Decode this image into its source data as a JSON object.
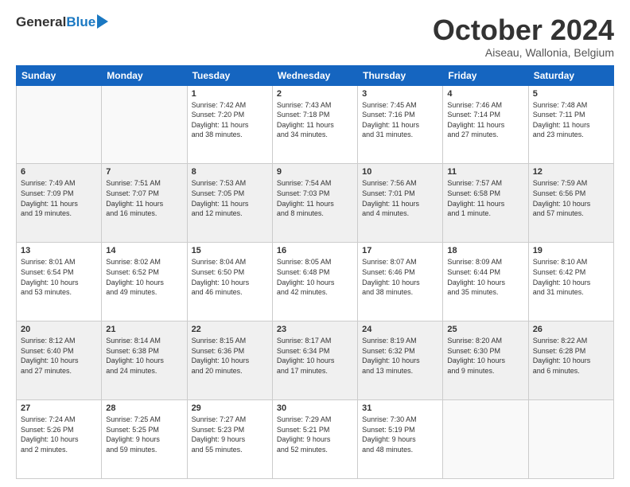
{
  "header": {
    "logo_line1": "General",
    "logo_line2": "Blue",
    "month": "October 2024",
    "location": "Aiseau, Wallonia, Belgium"
  },
  "columns": [
    "Sunday",
    "Monday",
    "Tuesday",
    "Wednesday",
    "Thursday",
    "Friday",
    "Saturday"
  ],
  "weeks": [
    [
      {
        "num": "",
        "info": ""
      },
      {
        "num": "",
        "info": ""
      },
      {
        "num": "1",
        "info": "Sunrise: 7:42 AM\nSunset: 7:20 PM\nDaylight: 11 hours\nand 38 minutes."
      },
      {
        "num": "2",
        "info": "Sunrise: 7:43 AM\nSunset: 7:18 PM\nDaylight: 11 hours\nand 34 minutes."
      },
      {
        "num": "3",
        "info": "Sunrise: 7:45 AM\nSunset: 7:16 PM\nDaylight: 11 hours\nand 31 minutes."
      },
      {
        "num": "4",
        "info": "Sunrise: 7:46 AM\nSunset: 7:14 PM\nDaylight: 11 hours\nand 27 minutes."
      },
      {
        "num": "5",
        "info": "Sunrise: 7:48 AM\nSunset: 7:11 PM\nDaylight: 11 hours\nand 23 minutes."
      }
    ],
    [
      {
        "num": "6",
        "info": "Sunrise: 7:49 AM\nSunset: 7:09 PM\nDaylight: 11 hours\nand 19 minutes."
      },
      {
        "num": "7",
        "info": "Sunrise: 7:51 AM\nSunset: 7:07 PM\nDaylight: 11 hours\nand 16 minutes."
      },
      {
        "num": "8",
        "info": "Sunrise: 7:53 AM\nSunset: 7:05 PM\nDaylight: 11 hours\nand 12 minutes."
      },
      {
        "num": "9",
        "info": "Sunrise: 7:54 AM\nSunset: 7:03 PM\nDaylight: 11 hours\nand 8 minutes."
      },
      {
        "num": "10",
        "info": "Sunrise: 7:56 AM\nSunset: 7:01 PM\nDaylight: 11 hours\nand 4 minutes."
      },
      {
        "num": "11",
        "info": "Sunrise: 7:57 AM\nSunset: 6:58 PM\nDaylight: 11 hours\nand 1 minute."
      },
      {
        "num": "12",
        "info": "Sunrise: 7:59 AM\nSunset: 6:56 PM\nDaylight: 10 hours\nand 57 minutes."
      }
    ],
    [
      {
        "num": "13",
        "info": "Sunrise: 8:01 AM\nSunset: 6:54 PM\nDaylight: 10 hours\nand 53 minutes."
      },
      {
        "num": "14",
        "info": "Sunrise: 8:02 AM\nSunset: 6:52 PM\nDaylight: 10 hours\nand 49 minutes."
      },
      {
        "num": "15",
        "info": "Sunrise: 8:04 AM\nSunset: 6:50 PM\nDaylight: 10 hours\nand 46 minutes."
      },
      {
        "num": "16",
        "info": "Sunrise: 8:05 AM\nSunset: 6:48 PM\nDaylight: 10 hours\nand 42 minutes."
      },
      {
        "num": "17",
        "info": "Sunrise: 8:07 AM\nSunset: 6:46 PM\nDaylight: 10 hours\nand 38 minutes."
      },
      {
        "num": "18",
        "info": "Sunrise: 8:09 AM\nSunset: 6:44 PM\nDaylight: 10 hours\nand 35 minutes."
      },
      {
        "num": "19",
        "info": "Sunrise: 8:10 AM\nSunset: 6:42 PM\nDaylight: 10 hours\nand 31 minutes."
      }
    ],
    [
      {
        "num": "20",
        "info": "Sunrise: 8:12 AM\nSunset: 6:40 PM\nDaylight: 10 hours\nand 27 minutes."
      },
      {
        "num": "21",
        "info": "Sunrise: 8:14 AM\nSunset: 6:38 PM\nDaylight: 10 hours\nand 24 minutes."
      },
      {
        "num": "22",
        "info": "Sunrise: 8:15 AM\nSunset: 6:36 PM\nDaylight: 10 hours\nand 20 minutes."
      },
      {
        "num": "23",
        "info": "Sunrise: 8:17 AM\nSunset: 6:34 PM\nDaylight: 10 hours\nand 17 minutes."
      },
      {
        "num": "24",
        "info": "Sunrise: 8:19 AM\nSunset: 6:32 PM\nDaylight: 10 hours\nand 13 minutes."
      },
      {
        "num": "25",
        "info": "Sunrise: 8:20 AM\nSunset: 6:30 PM\nDaylight: 10 hours\nand 9 minutes."
      },
      {
        "num": "26",
        "info": "Sunrise: 8:22 AM\nSunset: 6:28 PM\nDaylight: 10 hours\nand 6 minutes."
      }
    ],
    [
      {
        "num": "27",
        "info": "Sunrise: 7:24 AM\nSunset: 5:26 PM\nDaylight: 10 hours\nand 2 minutes."
      },
      {
        "num": "28",
        "info": "Sunrise: 7:25 AM\nSunset: 5:25 PM\nDaylight: 9 hours\nand 59 minutes."
      },
      {
        "num": "29",
        "info": "Sunrise: 7:27 AM\nSunset: 5:23 PM\nDaylight: 9 hours\nand 55 minutes."
      },
      {
        "num": "30",
        "info": "Sunrise: 7:29 AM\nSunset: 5:21 PM\nDaylight: 9 hours\nand 52 minutes."
      },
      {
        "num": "31",
        "info": "Sunrise: 7:30 AM\nSunset: 5:19 PM\nDaylight: 9 hours\nand 48 minutes."
      },
      {
        "num": "",
        "info": ""
      },
      {
        "num": "",
        "info": ""
      }
    ]
  ]
}
